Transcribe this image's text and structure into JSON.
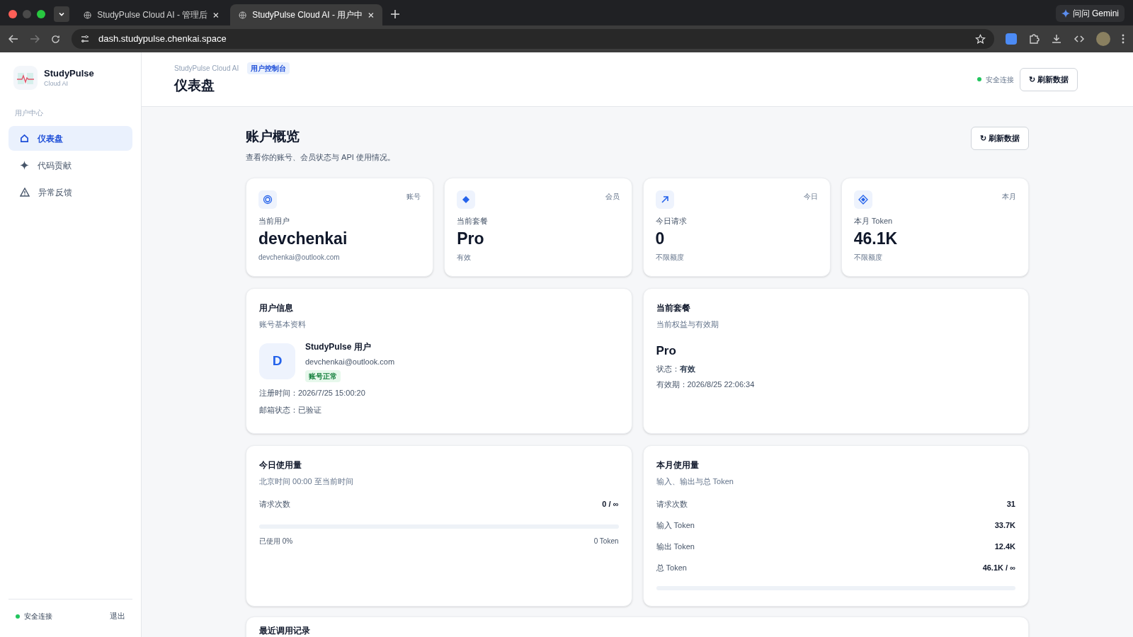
{
  "browser": {
    "tabs": [
      {
        "title": "StudyPulse Cloud AI - 管理后",
        "selected": false
      },
      {
        "title": "StudyPulse Cloud AI - 用户中",
        "selected": true
      }
    ],
    "url": "dash.studypulse.chenkai.space",
    "gemini_button": "问问 Gemini"
  },
  "sidebar": {
    "brand": {
      "name": "StudyPulse",
      "subtitle": "Cloud AI"
    },
    "section_label": "用户中心",
    "items": [
      {
        "label": "仪表盘",
        "selected": true
      },
      {
        "label": "代码贡献",
        "selected": false
      },
      {
        "label": "异常反馈",
        "selected": false
      }
    ],
    "footer": {
      "status": "安全连接",
      "logout": "退出"
    }
  },
  "header": {
    "breadcrumb": "StudyPulse Cloud AI",
    "badge": "用户控制台",
    "title": "仪表盘",
    "status": "安全连接",
    "refresh_button": "↻ 刷新数据"
  },
  "overview": {
    "title": "账户概览",
    "subtitle": "查看你的账号、会员状态与 API 使用情况。",
    "refresh_button": "↻ 刷新数据"
  },
  "stat_cards": [
    {
      "tag": "账号",
      "label": "当前用户",
      "value": "devchenkai",
      "note": "devchenkai@outlook.com"
    },
    {
      "tag": "会员",
      "label": "当前套餐",
      "value": "Pro",
      "note": "有效"
    },
    {
      "tag": "今日",
      "label": "今日请求",
      "value": "0",
      "note": "不限额度"
    },
    {
      "tag": "本月",
      "label": "本月 Token",
      "value": "46.1K",
      "note": "不限额度"
    }
  ],
  "user_info": {
    "title": "用户信息",
    "subtitle": "账号基本资料",
    "avatar": "D",
    "name": "StudyPulse 用户",
    "email": "devchenkai@outlook.com",
    "badge": "账号正常",
    "fields": [
      {
        "label": "注册时间：",
        "value": "2026/7/25 15:00:20"
      },
      {
        "label": "邮箱状态：",
        "value": "已验证"
      }
    ]
  },
  "plan": {
    "title": "当前套餐",
    "subtitle": "当前权益与有效期",
    "name": "Pro",
    "fields": [
      {
        "label": "状态：",
        "value": "有效",
        "bold": true
      },
      {
        "label": "有效期：",
        "value": "2026/8/25 22:06:34",
        "bold": false
      }
    ]
  },
  "today_usage": {
    "title": "今日使用量",
    "subtitle": "北京时间 00:00 至当前时间",
    "rows": [
      {
        "label": "请求次数",
        "value": "0 / ∞"
      }
    ],
    "progress": {
      "level": 0
    },
    "used": "已使用 0%",
    "tokens": "0 Token"
  },
  "month_usage": {
    "title": "本月使用量",
    "subtitle": "输入、输出与总 Token",
    "rows": [
      {
        "label": "请求次数",
        "value": "31"
      },
      {
        "label": "输入 Token",
        "value": "33.7K"
      },
      {
        "label": "输出 Token",
        "value": "12.4K"
      },
      {
        "label": "总 Token",
        "value": "46.1K / ∞"
      }
    ],
    "progress": {
      "level": 0
    }
  },
  "recent": {
    "title": "最近调用记录"
  }
}
